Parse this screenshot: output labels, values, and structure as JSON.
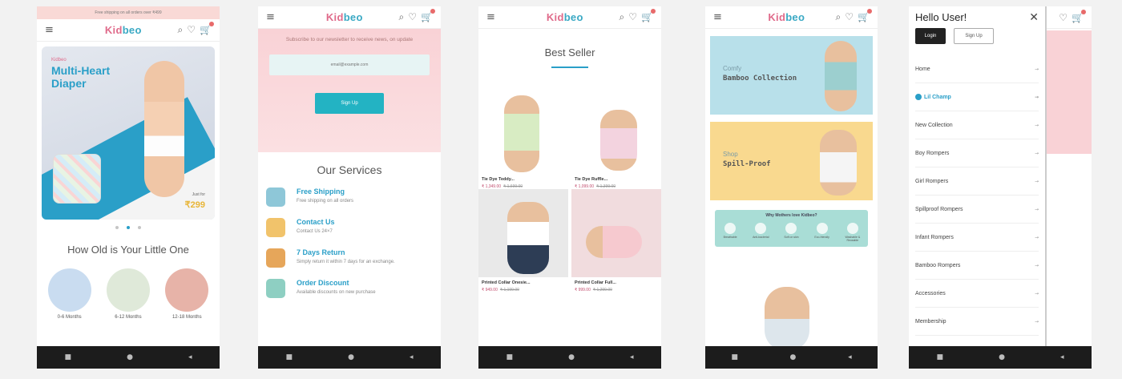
{
  "brand": {
    "logo_a": "Kid",
    "logo_b": "beo"
  },
  "icons": {
    "menu": "≡",
    "search": "⌕",
    "wishlist": "♡",
    "cart": "🛒",
    "close": "✕",
    "chevron": "→",
    "nav_back": "◂",
    "nav_home": "●",
    "nav_recents": "■"
  },
  "screen1": {
    "promo_bar": "Free shipping on all orders over ₹499",
    "hero_brand": "Kidbeo",
    "hero_title": "Multi-Heart Diaper",
    "hero_price_label": "Just for",
    "hero_price": "₹299",
    "section_title": "How Old is Your Little One",
    "ages": [
      {
        "label": "0-6 Months",
        "color": "#c9dcf0"
      },
      {
        "label": "6-12 Months",
        "color": "#dfe9d9"
      },
      {
        "label": "12-18 Months",
        "color": "#e7b3a8"
      }
    ]
  },
  "screen2": {
    "newsletter_text": "Subscribe to our newsletter to receive news, on update",
    "email_placeholder": "email@example.com",
    "signup_button": "Sign Up",
    "services_title": "Our Services",
    "services": [
      {
        "title": "Free Shipping",
        "desc": "Free shipping on all orders",
        "icon": "truck-icon",
        "color": "#8ec7d8"
      },
      {
        "title": "Contact Us",
        "desc": "Contact Us 24×7",
        "icon": "support-icon",
        "color": "#f1c36b"
      },
      {
        "title": "7 Days Return",
        "desc": "Simply return it within 7 days for an exchange.",
        "icon": "return-box-icon",
        "color": "#e6a65a"
      },
      {
        "title": "Order Discount",
        "desc": "Available discounts on new purchase",
        "icon": "discount-icon",
        "color": "#8ecfc2"
      }
    ]
  },
  "screen3": {
    "title": "Best Seller",
    "products": [
      {
        "name": "Tie Dye Teddy...",
        "price": "₹ 1,349.00",
        "mrp": "₹ 1,699.00",
        "bg": "#ffffff",
        "outfit": "#d8ecc3"
      },
      {
        "name": "Tie Dye Ruffle...",
        "price": "₹ 1,099.00",
        "mrp": "₹ 1,399.00",
        "bg": "#ffffff",
        "outfit": "#f3d3df"
      },
      {
        "name": "Printed Collar Onesie...",
        "price": "₹ 949.00",
        "mrp": "₹ 1,199.00",
        "bg": "#e9e9e9",
        "outfit": "#ffffff"
      },
      {
        "name": "Printed Collar Full...",
        "price": "₹ 999.00",
        "mrp": "₹ 1,299.00",
        "bg": "#f1dcde",
        "outfit": "#f6c9cf"
      }
    ]
  },
  "screen4": {
    "banners": [
      {
        "small": "Comfy",
        "large": "Bamboo Collection",
        "bg": "#b8e0ea"
      },
      {
        "small": "Shop",
        "large": "Spill-Proof",
        "bg": "#f9d98f"
      }
    ],
    "why_title": "Why Mothers love Kidbeo?",
    "why_items": [
      "Breathable",
      "Anti-bacterial",
      "Soft on skin",
      "Eco-friendly",
      "Washable & Reusable"
    ]
  },
  "screen5": {
    "greeting": "Hello User!",
    "login": "Login",
    "signup": "Sign Up",
    "menu_items": [
      "Home",
      "Lil Champ",
      "New Collection",
      "Boy Rompers",
      "Girl Rompers",
      "Spillproof Rompers",
      "Infant Rompers",
      "Bamboo Rompers",
      "Accessories",
      "Membership"
    ]
  }
}
